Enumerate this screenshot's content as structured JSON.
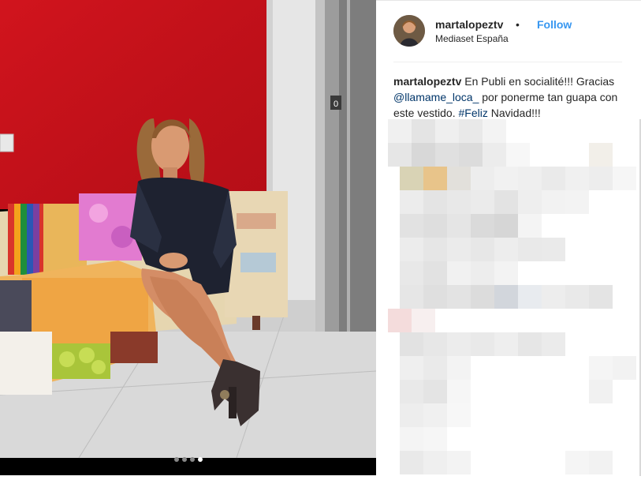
{
  "post": {
    "username": "martalopeztv",
    "separator": "•",
    "follow_label": "Follow",
    "location": "Mediaset España",
    "caption": {
      "username": "martalopeztv",
      "text_1": " En Publi en socialité!!! Gracias ",
      "mention": "@llamame_loca_",
      "text_2": " por ponerme tan guapa con este vestido. ",
      "hashtag": "#Feliz",
      "text_3": " Navidad!!!"
    },
    "carousel": {
      "count": 4,
      "active_index": 3
    },
    "elevator_label": "0"
  },
  "icons": {
    "avatar": "profile-avatar",
    "carousel_dot": "dot"
  },
  "colors": {
    "follow": "#3897f0",
    "link": "#003569",
    "text": "#262626",
    "wall": "#c8101a"
  }
}
